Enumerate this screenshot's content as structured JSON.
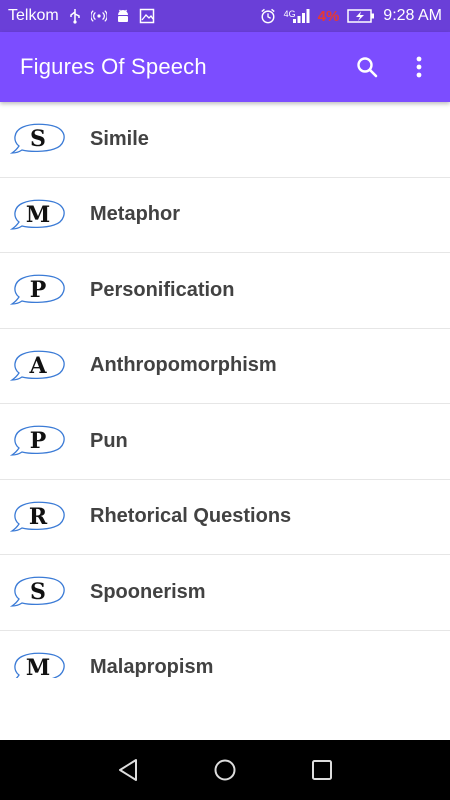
{
  "status_bar": {
    "carrier": "Telkom",
    "network": "4G",
    "battery_percent": "4%",
    "time": "9:28 AM"
  },
  "app_bar": {
    "title": "Figures Of Speech",
    "search_icon": "search-icon",
    "overflow_icon": "more-vert-icon"
  },
  "colors": {
    "status_bar": "#6a3fd8",
    "app_bar": "#7c4dff",
    "battery_low": "#e53935",
    "bubble_outline": "#3b7bd6"
  },
  "items": [
    {
      "letter": "S",
      "label": "Simile"
    },
    {
      "letter": "M",
      "label": "Metaphor"
    },
    {
      "letter": "P",
      "label": "Personification"
    },
    {
      "letter": "A",
      "label": "Anthropomorphism"
    },
    {
      "letter": "P",
      "label": "Pun"
    },
    {
      "letter": "R",
      "label": "Rhetorical Questions"
    },
    {
      "letter": "S",
      "label": "Spoonerism"
    },
    {
      "letter": "M",
      "label": "Malapropism"
    }
  ],
  "nav_bar": {
    "back_icon": "back-triangle-icon",
    "home_icon": "home-circle-icon",
    "recents_icon": "recents-square-icon"
  }
}
